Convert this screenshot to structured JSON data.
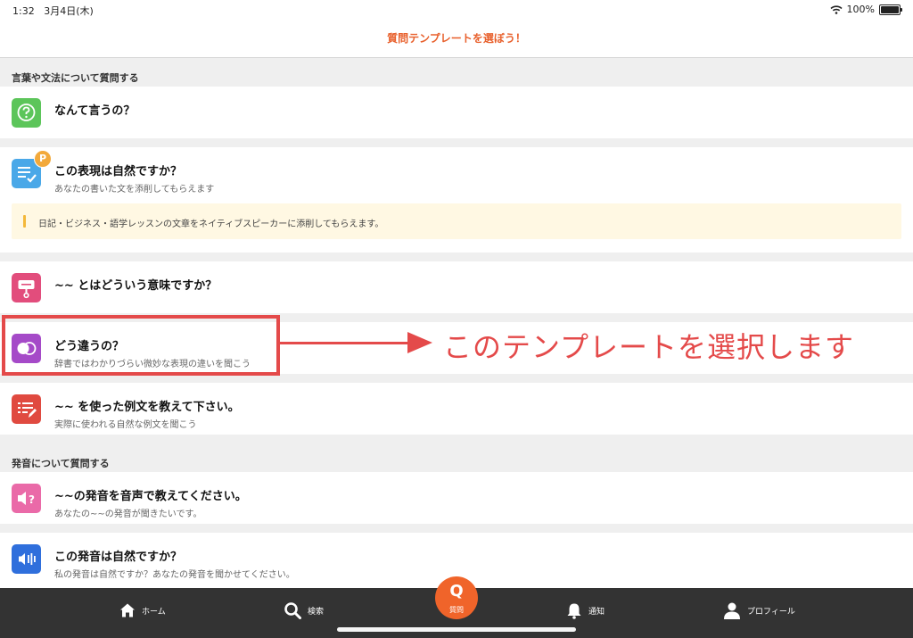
{
  "status": {
    "time": "1:32",
    "date": "3月4日(木)",
    "battery": "100%"
  },
  "header": {
    "title": "質問テンプレートを選ぼう！"
  },
  "sections": [
    {
      "title": "言葉や文法について質問する"
    },
    {
      "title": "発音について質問する"
    }
  ],
  "templates": [
    {
      "title": "なんて言うの？",
      "subtitle": "",
      "icon": "question-bubble-icon",
      "color": "#5cc55a"
    },
    {
      "title": "この表現は自然ですか？",
      "subtitle": "あなたの書いた文を添削してもらえます",
      "icon": "checklist-icon",
      "color": "#4aa8e8",
      "badge": "P"
    },
    {
      "title": "~~ とはどういう意味ですか？",
      "subtitle": "",
      "icon": "signpost-icon",
      "color": "#e24d7c"
    },
    {
      "title": "どう違うの？",
      "subtitle": "辞書ではわかりづらい微妙な表現の違いを聞こう",
      "icon": "overlap-circles-icon",
      "color": "#a54ac8"
    },
    {
      "title": "~~ を使った例文を教えて下さい。",
      "subtitle": "実際に使われる自然な例文を聞こう",
      "icon": "list-pencil-icon",
      "color": "#e04a40"
    },
    {
      "title": "~~の発音を音声で教えてください。",
      "subtitle": "あなたの~~の発音が聞きたいです。",
      "icon": "speaker-question-icon",
      "color": "#ea6aa8"
    },
    {
      "title": "この発音は自然ですか？",
      "subtitle": "私の発音は自然ですか？あなたの発音を聞かせてください。",
      "icon": "speaker-sound-icon",
      "color": "#2f6fdc"
    }
  ],
  "notice": {
    "text": "日記・ビジネス・語学レッスンの文章をネイティブスピーカーに添削してもらえます。"
  },
  "annotation": {
    "text": "このテンプレートを選択します"
  },
  "tabbar": {
    "home": "ホーム",
    "search": "検索",
    "question": "質問",
    "question_glyph": "Q",
    "notifications": "通知",
    "profile": "プロフィール"
  }
}
